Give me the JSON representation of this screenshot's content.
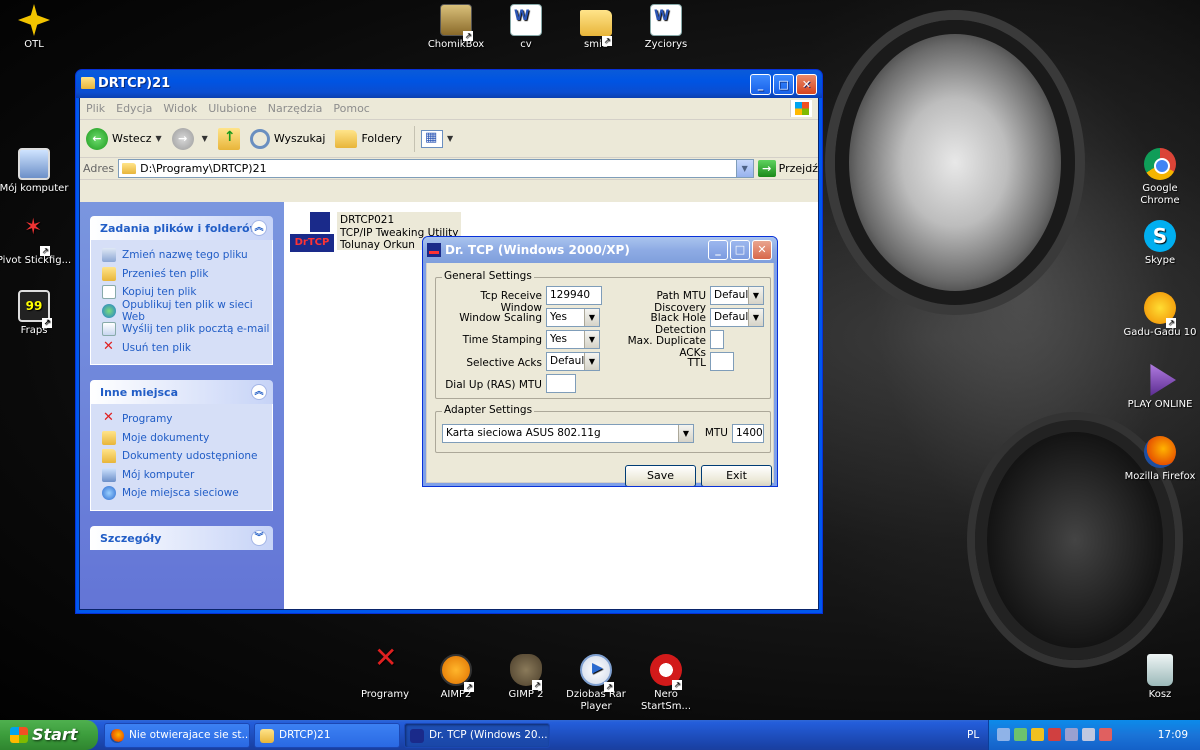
{
  "desktop": {
    "icons": [
      {
        "label": "OTL",
        "icon": "otl-icon"
      },
      {
        "label": "ChomikBox",
        "icon": "chomikbox-icon"
      },
      {
        "label": "cv",
        "icon": "word-doc-icon"
      },
      {
        "label": "smie",
        "icon": "folder-icon"
      },
      {
        "label": "Zyciorys",
        "icon": "word-doc-icon"
      },
      {
        "label": "Mój komputer",
        "icon": "my-computer-icon"
      },
      {
        "label": "Pivot Stickfig...",
        "icon": "pivot-icon"
      },
      {
        "label": "Fraps",
        "icon": "fraps-icon"
      },
      {
        "label": "Google Chrome",
        "icon": "chrome-icon"
      },
      {
        "label": "Skype",
        "icon": "skype-icon"
      },
      {
        "label": "Gadu-Gadu 10",
        "icon": "gadu-gadu-icon"
      },
      {
        "label": "PLAY ONLINE",
        "icon": "play-online-icon"
      },
      {
        "label": "Mozilla Firefox",
        "icon": "firefox-icon"
      },
      {
        "label": "Programy",
        "icon": "programs-icon"
      },
      {
        "label": "AIMP2",
        "icon": "aimp-icon"
      },
      {
        "label": "GIMP 2",
        "icon": "gimp-icon"
      },
      {
        "label": "Dziobas Rar Player",
        "icon": "rar-player-icon"
      },
      {
        "label": "Nero StartSm...",
        "icon": "nero-icon"
      },
      {
        "label": "Kosz",
        "icon": "recycle-bin-icon"
      }
    ]
  },
  "explorer": {
    "title": "DRTCP)21",
    "menu": [
      "Plik",
      "Edycja",
      "Widok",
      "Ulubione",
      "Narzędzia",
      "Pomoc"
    ],
    "toolbar": {
      "back": "Wstecz",
      "search": "Wyszukaj",
      "folders": "Foldery"
    },
    "address": {
      "label": "Adres",
      "value": "D:\\Programy\\DRTCP)21",
      "go": "Przejdź"
    },
    "tasks_panel": {
      "title": "Zadania plików i folderów",
      "items": [
        "Zmień nazwę tego pliku",
        "Przenieś ten plik",
        "Kopiuj ten plik",
        "Opublikuj ten plik w sieci Web",
        "Wyślij ten plik pocztą e-mail",
        "Usuń ten plik"
      ]
    },
    "places_panel": {
      "title": "Inne miejsca",
      "items": [
        "Programy",
        "Moje dokumenty",
        "Dokumenty udostępnione",
        "Mój komputer",
        "Moje miejsca sieciowe"
      ]
    },
    "details_panel": {
      "title": "Szczegóły"
    },
    "file": {
      "name": "DRTCP021",
      "description": "TCP/IP Tweaking Utility",
      "author": "Tolunay Orkun",
      "icon_text": "DrTCP"
    }
  },
  "drtcp": {
    "title": "Dr. TCP (Windows 2000/XP)",
    "general": {
      "legend": "General Settings",
      "tcp_receive_window": {
        "label": "Tcp Receive Window",
        "value": "129940"
      },
      "window_scaling": {
        "label": "Window Scaling",
        "value": "Yes"
      },
      "time_stamping": {
        "label": "Time Stamping",
        "value": "Yes"
      },
      "selective_acks": {
        "label": "Selective Acks",
        "value": "Default"
      },
      "dial_up_mtu": {
        "label": "Dial Up (RAS) MTU",
        "value": ""
      },
      "path_mtu": {
        "label": "Path MTU Discovery",
        "value": "Default"
      },
      "black_hole": {
        "label": "Black Hole Detection",
        "value": "Default"
      },
      "max_dup_acks": {
        "label": "Max. Duplicate ACKs",
        "value": ""
      },
      "ttl": {
        "label": "TTL",
        "value": ""
      }
    },
    "adapter": {
      "legend": "Adapter Settings",
      "adapter_value": "Karta sieciowa ASUS 802.11g",
      "mtu_label": "MTU",
      "mtu_value": "1400"
    },
    "save": "Save",
    "exit": "Exit"
  },
  "taskbar": {
    "start": "Start",
    "tasks": [
      "Nie otwierajace sie st...",
      "DRTCP)21",
      "Dr. TCP (Windows 20..."
    ],
    "lang": "PL",
    "clock": "17:09"
  }
}
